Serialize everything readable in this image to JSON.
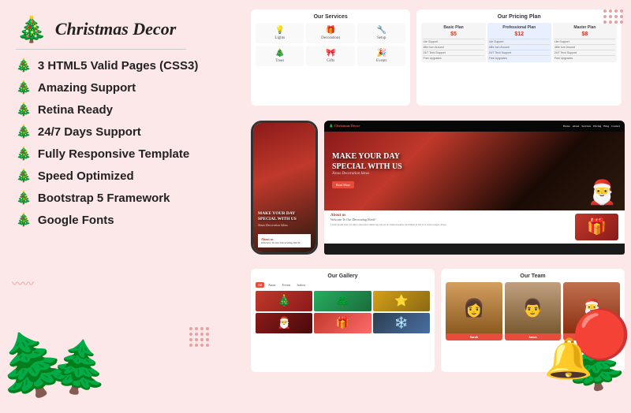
{
  "brand": {
    "title": "Christmas Decor",
    "tree_icon": "🎄"
  },
  "features": [
    {
      "id": "html5",
      "label": "3 HTML5 Valid Pages (CSS3)",
      "icon": "🎄"
    },
    {
      "id": "support",
      "label": "Amazing Support",
      "icon": "🎄"
    },
    {
      "id": "retina",
      "label": "Retina Ready",
      "icon": "🎄"
    },
    {
      "id": "support247",
      "label": "24/7 Days Support",
      "icon": "🎄"
    },
    {
      "id": "responsive",
      "label": "Fully Responsive Template",
      "icon": "🎄"
    },
    {
      "id": "speed",
      "label": "Speed Optimized",
      "icon": "🎄"
    },
    {
      "id": "bootstrap",
      "label": "Bootstrap 5 Framework",
      "icon": "🎄"
    },
    {
      "id": "fonts",
      "label": "Google Fonts",
      "icon": "🎄"
    }
  ],
  "services": {
    "title": "Our Services",
    "items": [
      {
        "label": "Lights",
        "icon": "💡"
      },
      {
        "label": "Decorations",
        "icon": "🎁"
      },
      {
        "label": "Setup",
        "icon": "🔧"
      },
      {
        "label": "Trees",
        "icon": "🎄"
      },
      {
        "label": "Gifts",
        "icon": "🎀"
      },
      {
        "label": "Events",
        "icon": "🎉"
      }
    ]
  },
  "pricing": {
    "title": "Our Pricing Plan",
    "plans": [
      {
        "name": "Basic Plan",
        "price": "$5",
        "featured": false
      },
      {
        "name": "Professional Plan",
        "price": "$12",
        "featured": true
      },
      {
        "name": "Master Plan",
        "price": "$8",
        "featured": false
      }
    ]
  },
  "hero": {
    "tagline": "MAKE YOUR DAY SPECIAL WITH US",
    "subtitle": "Xmas Decoration Ideas",
    "btn": "Read More"
  },
  "about": {
    "title": "About us",
    "subtitle": "Welcome To Our Decorating World"
  },
  "gallery": {
    "title": "Our Gallery",
    "filters": [
      "All",
      "Xmas",
      "Events",
      "Indoor"
    ]
  },
  "team": {
    "title": "Our Team"
  }
}
